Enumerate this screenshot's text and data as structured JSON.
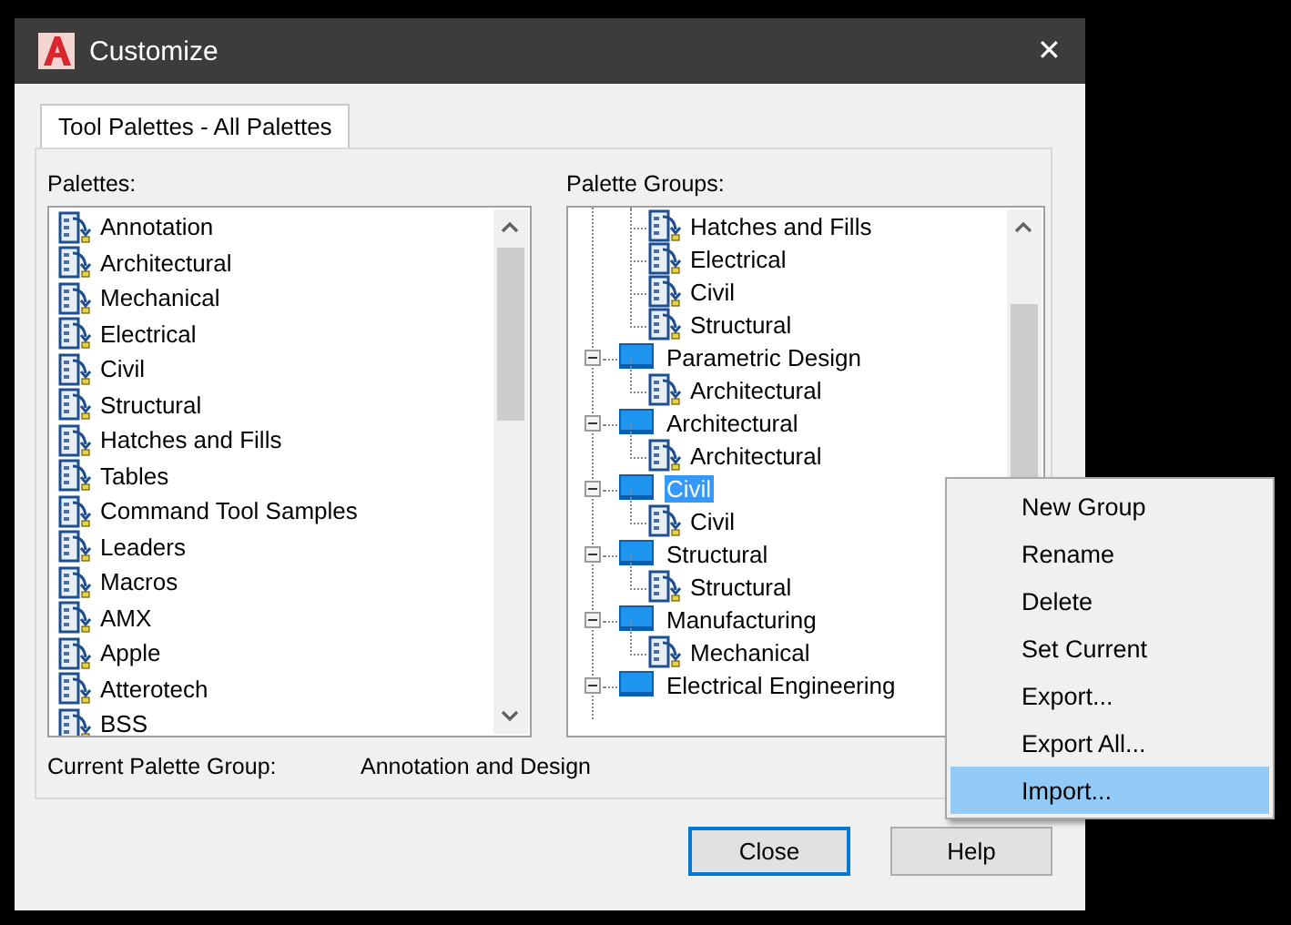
{
  "window": {
    "title": "Customize",
    "close_glyph": "✕"
  },
  "tabs": [
    {
      "label": "Tool Palettes - All Palettes",
      "selected": true
    }
  ],
  "palettes": {
    "label": "Palettes:",
    "items": [
      "Annotation",
      "Architectural",
      "Mechanical",
      "Electrical",
      "Civil",
      "Structural",
      "Hatches and Fills",
      "Tables",
      "Command Tool Samples",
      "Leaders",
      "Macros",
      "AMX",
      "Apple",
      "Atterotech",
      "BSS"
    ]
  },
  "palette_groups": {
    "label": "Palette Groups:",
    "leading_children": [
      "Hatches and Fills",
      "Electrical",
      "Civil",
      "Structural"
    ],
    "groups": [
      {
        "label": "Parametric Design",
        "expanded": true,
        "selected": false,
        "children": [
          "Architectural"
        ]
      },
      {
        "label": "Architectural",
        "expanded": true,
        "selected": false,
        "children": [
          "Architectural"
        ]
      },
      {
        "label": "Civil",
        "expanded": true,
        "selected": true,
        "children": [
          "Civil"
        ]
      },
      {
        "label": "Structural",
        "expanded": true,
        "selected": false,
        "children": [
          "Structural"
        ]
      },
      {
        "label": "Manufacturing",
        "expanded": true,
        "selected": false,
        "children": [
          "Mechanical"
        ]
      },
      {
        "label": "Electrical Engineering",
        "expanded": true,
        "selected": false
      }
    ]
  },
  "current_group": {
    "label": "Current Palette Group:",
    "value": "Annotation and Design"
  },
  "buttons": [
    {
      "label": "Close",
      "default": true
    },
    {
      "label": "Help",
      "default": false
    }
  ],
  "context_menu": [
    {
      "label": "New Group",
      "highlighted": false
    },
    {
      "label": "Rename",
      "highlighted": false
    },
    {
      "label": "Delete",
      "highlighted": false
    },
    {
      "label": "Set Current",
      "highlighted": false
    },
    {
      "label": "Export...",
      "highlighted": false
    },
    {
      "label": "Export All...",
      "highlighted": false
    },
    {
      "label": "Import...",
      "highlighted": true
    }
  ]
}
